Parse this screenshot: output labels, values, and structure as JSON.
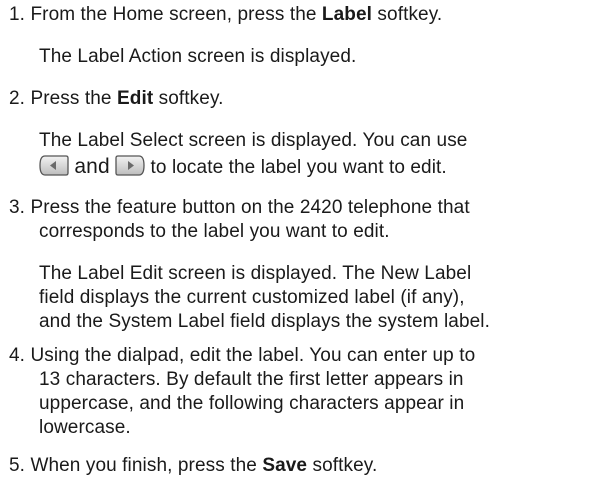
{
  "steps": [
    {
      "number": "1.",
      "instruction": {
        "before": "From the Home screen, press the ",
        "bold": "Label",
        "after": " softkey."
      },
      "result": [
        "The Label Action screen is displayed."
      ]
    },
    {
      "number": "2.",
      "instruction": {
        "before": "Press the ",
        "bold": "Edit",
        "after": " softkey."
      },
      "result": [
        "The Label Select screen is displayed. You can use",
        {
          "and": "and",
          "after": "to locate the label you want to edit."
        }
      ],
      "icons": [
        "left-arrow-key-icon",
        "right-arrow-key-icon"
      ]
    },
    {
      "number": "3.",
      "instruction_lines": [
        "Press the feature button on the 2420 telephone that",
        "corresponds to the label you want to edit."
      ],
      "result": [
        "The Label Edit screen is displayed. The New Label",
        "field displays the current customized label (if any),",
        "and the System Label field displays the system label."
      ]
    },
    {
      "number": "4.",
      "instruction_lines": [
        "Using the dialpad, edit the label. You can enter up to",
        "13 characters. By default the first letter appears in",
        "uppercase, and the following characters appear in",
        "lowercase."
      ]
    },
    {
      "number": "5.",
      "instruction": {
        "before": "When you finish, press the ",
        "bold": "Save",
        "after": " softkey."
      }
    }
  ]
}
